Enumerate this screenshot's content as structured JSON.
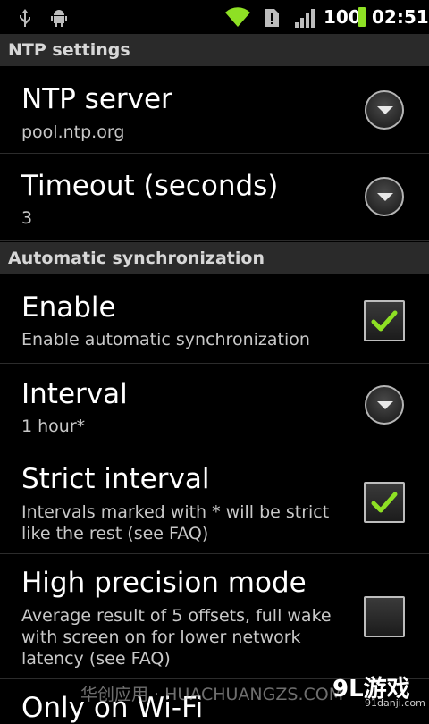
{
  "status_bar": {
    "icons": [
      "usb-icon",
      "android-debug-icon",
      "wifi-icon",
      "alert-icon",
      "signal-icon"
    ],
    "battery": "100",
    "time": "02:51",
    "battery_color": "#8ee024"
  },
  "sections": [
    {
      "header": "NTP settings",
      "items": [
        {
          "title": "NTP server",
          "summary": "pool.ntp.org",
          "control": "dropdown"
        },
        {
          "title": "Timeout (seconds)",
          "summary": "3",
          "control": "dropdown"
        }
      ]
    },
    {
      "header": "Automatic synchronization",
      "items": [
        {
          "title": "Enable",
          "summary": "Enable automatic synchronization",
          "control": "checkbox",
          "checked": true
        },
        {
          "title": "Interval",
          "summary": "1 hour*",
          "control": "dropdown"
        },
        {
          "title": "Strict interval",
          "summary": "Intervals marked with * will be strict like the rest (see FAQ)",
          "control": "checkbox",
          "checked": true
        },
        {
          "title": "High precision mode",
          "summary": "Average result of 5 offsets, full wake with screen on for lower network latency (see FAQ)",
          "control": "checkbox",
          "checked": false
        },
        {
          "title": "Only on Wi-Fi",
          "summary": "",
          "control": "checkbox"
        }
      ]
    }
  ],
  "watermark": {
    "text": "华创应用 · HUACHUANGZS.COM",
    "logo": "9L游戏",
    "logo_sub": "91danji.com"
  },
  "colors": {
    "check": "#8ee024",
    "header_bg": "#2a2a2a"
  }
}
